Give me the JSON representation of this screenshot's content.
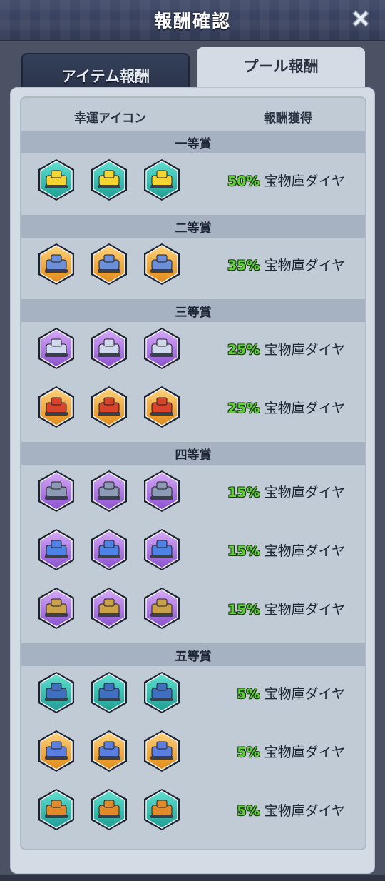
{
  "window": {
    "title": "報酬確認"
  },
  "tabs": [
    {
      "label": "アイテム報酬",
      "active": false
    },
    {
      "label": "プール報酬",
      "active": true
    }
  ],
  "columns": {
    "lucky_icon": "幸運アイコン",
    "reward": "報酬獲得"
  },
  "reward_name": "宝物庫ダイヤ",
  "colors": {
    "green": "#5fd23a",
    "teal": "#27b9a8",
    "orange": "#f0a22a",
    "purple": "#a874e0"
  },
  "sections": [
    {
      "label": "一等賞",
      "rows": [
        {
          "percent": "50%",
          "reward": "宝物庫ダイヤ",
          "bg": "teal",
          "unit": "tank-yellow-icon"
        }
      ]
    },
    {
      "label": "二等賞",
      "rows": [
        {
          "percent": "35%",
          "reward": "宝物庫ダイヤ",
          "bg": "orange",
          "unit": "ship-icon"
        }
      ]
    },
    {
      "label": "三等賞",
      "rows": [
        {
          "percent": "25%",
          "reward": "宝物庫ダイヤ",
          "bg": "purple",
          "unit": "jet-icon"
        },
        {
          "percent": "25%",
          "reward": "宝物庫ダイヤ",
          "bg": "orange",
          "unit": "mech-red-icon"
        }
      ]
    },
    {
      "label": "四等賞",
      "rows": [
        {
          "percent": "15%",
          "reward": "宝物庫ダイヤ",
          "bg": "purple",
          "unit": "battleship-icon"
        },
        {
          "percent": "15%",
          "reward": "宝物庫ダイヤ",
          "bg": "purple",
          "unit": "plane-blue-icon"
        },
        {
          "percent": "15%",
          "reward": "宝物庫ダイヤ",
          "bg": "purple",
          "unit": "robot-gold-icon"
        }
      ]
    },
    {
      "label": "五等賞",
      "rows": [
        {
          "percent": "5%",
          "reward": "宝物庫ダイヤ",
          "bg": "teal",
          "unit": "tank-blue-icon"
        },
        {
          "percent": "5%",
          "reward": "宝物庫ダイヤ",
          "bg": "orange",
          "unit": "fighter-icon"
        },
        {
          "percent": "5%",
          "reward": "宝物庫ダイヤ",
          "bg": "teal",
          "unit": "helicopter-icon"
        }
      ]
    }
  ]
}
